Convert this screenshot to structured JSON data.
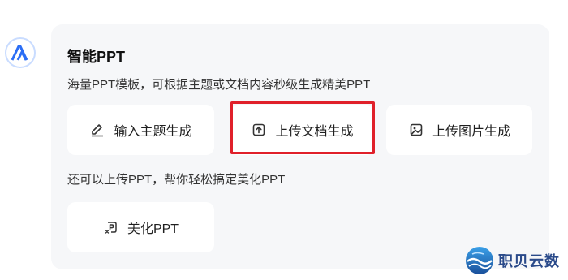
{
  "assistant": {
    "avatar_icon": "ai-logo-icon"
  },
  "card": {
    "title": "智能PPT",
    "description": "海量PPT模板，可根据主题或文档内容秒级生成精美PPT",
    "options": [
      {
        "label": "输入主题生成",
        "icon": "pen-icon"
      },
      {
        "label": "上传文档生成",
        "icon": "upload-file-icon"
      },
      {
        "label": "上传图片生成",
        "icon": "image-icon"
      }
    ],
    "sub_description": "还可以上传PPT，帮你轻松搞定美化PPT",
    "beautify": {
      "label": "美化PPT",
      "icon": "ppt-beautify-icon"
    }
  },
  "highlight_color": "#e0202a",
  "watermark": {
    "text": "职贝云数"
  }
}
